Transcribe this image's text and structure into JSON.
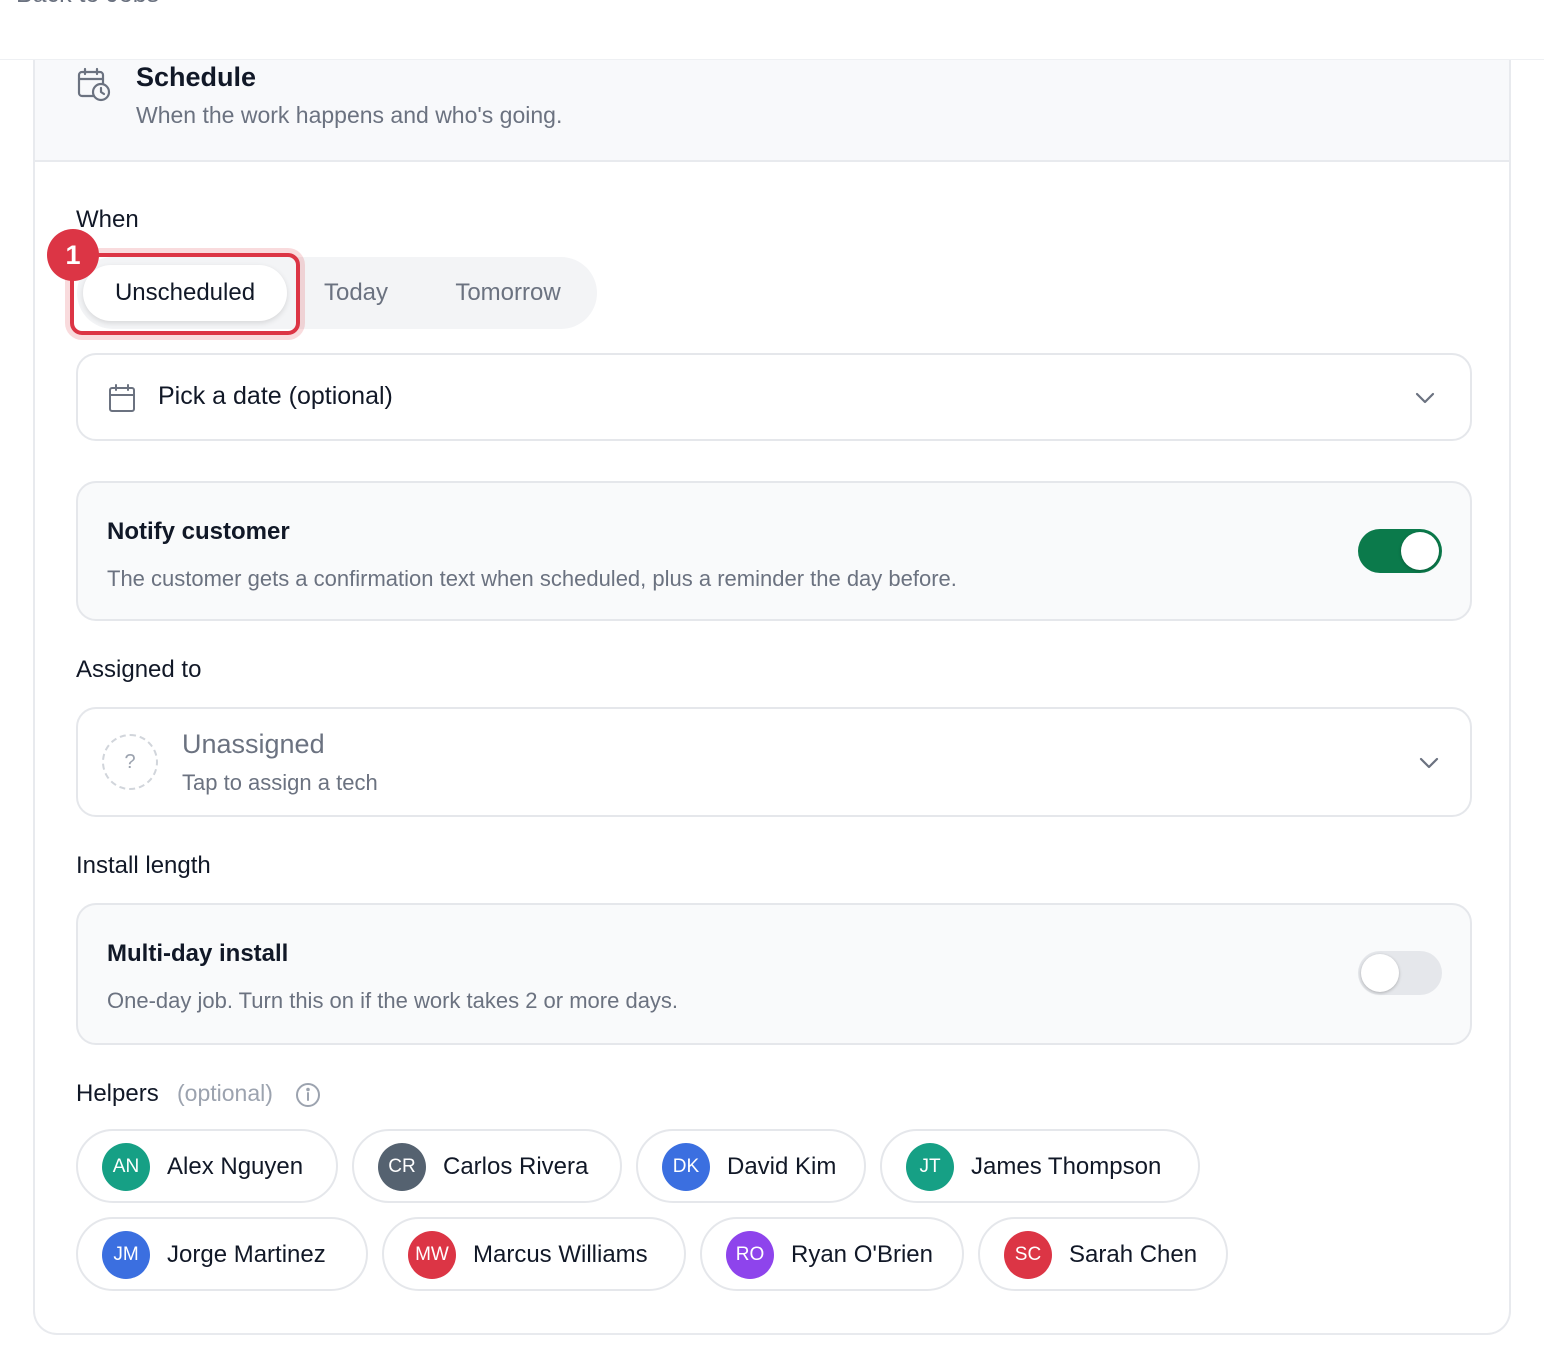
{
  "nav": {
    "back_label": "Back to Jobs"
  },
  "section": {
    "title": "Schedule",
    "subtitle": "When the work happens and who's going."
  },
  "when": {
    "label": "When",
    "options": [
      "Unscheduled",
      "Today",
      "Tomorrow"
    ],
    "selected": "Unscheduled",
    "annotation_badge": "1"
  },
  "date_picker": {
    "placeholder": "Pick a date (optional)"
  },
  "notify": {
    "title": "Notify customer",
    "description": "The customer gets a confirmation text when scheduled, plus a reminder the day before.",
    "enabled": true
  },
  "assigned": {
    "label": "Assigned to",
    "value": "Unassigned",
    "hint": "Tap to assign a tech",
    "avatar_glyph": "?"
  },
  "install_length": {
    "label": "Install length",
    "title": "Multi-day install",
    "description": "One-day job. Turn this on if the work takes 2 or more days.",
    "enabled": false
  },
  "helpers": {
    "label": "Helpers",
    "optional_label": "(optional)",
    "people": [
      {
        "initials": "AN",
        "name": "Alex Nguyen",
        "color": "#16a085"
      },
      {
        "initials": "CR",
        "name": "Carlos Rivera",
        "color": "#556270"
      },
      {
        "initials": "DK",
        "name": "David Kim",
        "color": "#3b6fe0"
      },
      {
        "initials": "JT",
        "name": "James Thompson",
        "color": "#16a085"
      },
      {
        "initials": "JM",
        "name": "Jorge Martinez",
        "color": "#3b6fe0"
      },
      {
        "initials": "MW",
        "name": "Marcus Williams",
        "color": "#dc3545"
      },
      {
        "initials": "RO",
        "name": "Ryan O'Brien",
        "color": "#8e44ec"
      },
      {
        "initials": "SC",
        "name": "Sarah Chen",
        "color": "#dc3545"
      }
    ]
  },
  "colors": {
    "accent_green": "#0b7a4b",
    "highlight_red": "#dc3545",
    "toggle_off": "#e5e7eb"
  }
}
